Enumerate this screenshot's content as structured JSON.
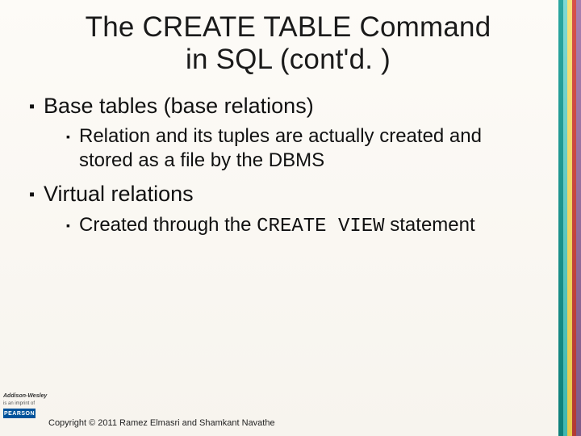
{
  "title_line1": "The CREATE TABLE Command",
  "title_line2": "in SQL (cont'd. )",
  "bullets": {
    "b1": "Base tables (base relations)",
    "b1_1": "Relation and its tuples are actually created and stored as a file by the DBMS",
    "b2": "Virtual relations",
    "b2_1_a": "Created through the ",
    "b2_1_code": "CREATE VIEW",
    "b2_1_b": "  statement"
  },
  "footer": {
    "imprint1": "Addison-Wesley",
    "imprint2": "is an imprint of",
    "publisher": "PEARSON",
    "copyright": "Copyright © 2011 Ramez Elmasri and Shamkant Navathe"
  }
}
